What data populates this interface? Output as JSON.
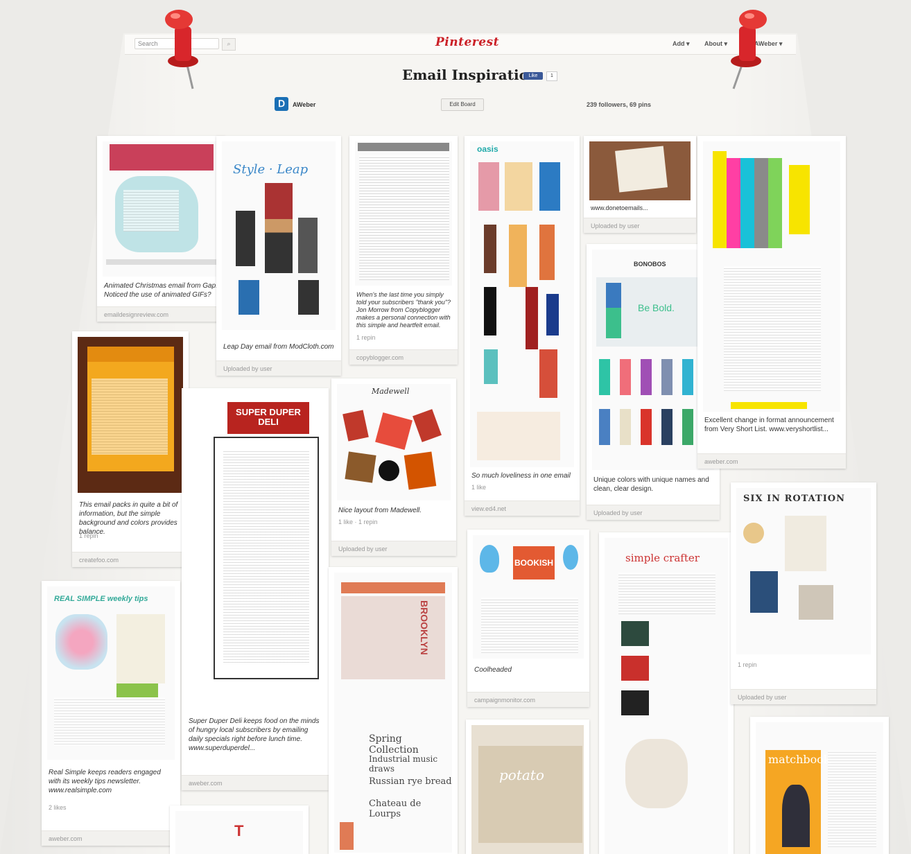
{
  "app": {
    "logo": "Pinterest",
    "search_placeholder": "Search",
    "nav": {
      "add": "Add ▾",
      "about": "About ▾",
      "user": "AWeber ▾"
    }
  },
  "board": {
    "title": "Email Inspiration",
    "like_label": "Like",
    "like_count": "1",
    "owner": "AWeber",
    "edit_label": "Edit Board",
    "stats": "239 followers, 69 pins"
  },
  "pins": [
    {
      "desc": "Animated Christmas email from Gap. Noticed the use of animated GIFs?",
      "meta": "",
      "source": "emaildesignreview.com"
    },
    {
      "desc": "Leap Day email from ModCloth.com",
      "meta": "",
      "source": "Uploaded by user"
    },
    {
      "desc": "When's the last time you simply told your subscribers \"thank you\"? Jon Morrow from Copyblogger makes a personal connection with this simple and heartfelt email.",
      "meta": "1 repin",
      "source": "copyblogger.com"
    },
    {
      "desc": "So much loveliness in one email",
      "meta": "1 like",
      "source": "view.ed4.net"
    },
    {
      "desc": "www.donetoemails...",
      "meta": "",
      "source": "Uploaded by user"
    },
    {
      "desc": "Excellent change in format announcement from Very Short List. www.veryshortlist...",
      "meta": "",
      "source": "aweber.com"
    },
    {
      "desc": "Unique colors with unique names and clean, clear design.",
      "meta": "",
      "source": "Uploaded by user"
    },
    {
      "desc": "This email packs in quite a bit of information, but the simple background and colors provides balance.",
      "meta": "1 repin",
      "source": "createfoo.com"
    },
    {
      "desc": "Super Duper Deli keeps food on the minds of hungry local subscribers by emailing daily specials right before lunch time. www.superduperdel...",
      "meta": "",
      "source": "aweber.com"
    },
    {
      "desc": "Nice layout from Madewell.",
      "meta": "1 like · 1 repin",
      "source": "Uploaded by user"
    },
    {
      "desc": "Coolheaded",
      "meta": "",
      "source": "campaignmonitor.com"
    },
    {
      "desc": "Real Simple keeps readers engaged with its weekly tips newsletter. www.realsimple.com",
      "meta": "2 likes",
      "source": "aweber.com"
    },
    {
      "desc": "",
      "meta": "1 repin",
      "source": "Uploaded by user"
    }
  ],
  "image_text": {
    "super_duper": "SUPER DUPER DELI",
    "madewell": "Madewell",
    "bookish": "BOOKISH",
    "bonobos": "BONOBOS",
    "be_bold": "Be Bold.",
    "oasis": "oasis",
    "six_in_rotation": "SIX IN ROTATION",
    "simple_crafter": "simple crafter",
    "real_simple": "REAL SIMPLE weekly tips",
    "matchbook": "matchbook",
    "brooklyn": "BROOKLYN",
    "spring_collection": "Spring Collection",
    "industrial_music": "Industrial music draws",
    "russian_rye": "Russian rye bread",
    "chateau": "Chateau de Lourps",
    "potato": "potato"
  },
  "colors": {
    "brand": "#cb2027",
    "tack": "#d8262b",
    "paper": "#f6f5f2"
  }
}
